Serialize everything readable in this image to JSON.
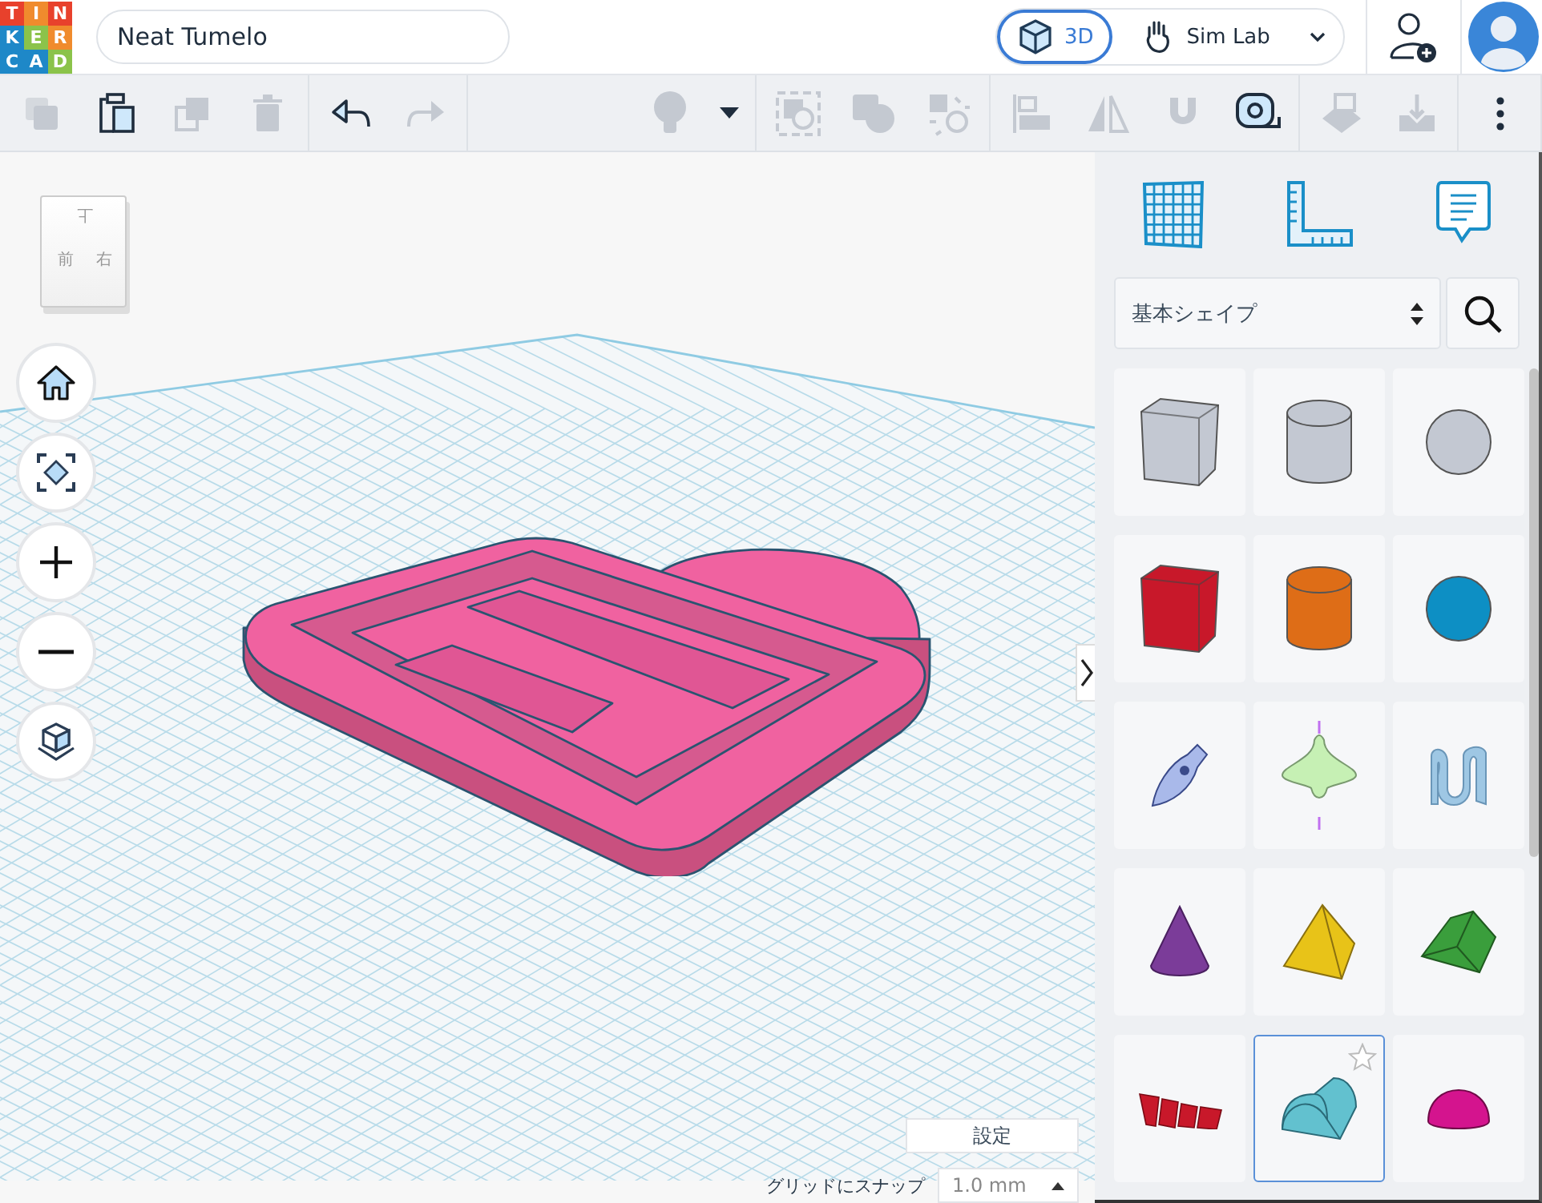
{
  "logo": {
    "letters": [
      {
        "char": "T",
        "color": "#e8412c"
      },
      {
        "char": "I",
        "color": "#f08b2d"
      },
      {
        "char": "N",
        "color": "#e8412c"
      },
      {
        "char": "K",
        "color": "#1e88c8"
      },
      {
        "char": "E",
        "color": "#8bc34a"
      },
      {
        "char": "R",
        "color": "#f08b2d"
      },
      {
        "char": "C",
        "color": "#1e88c8"
      },
      {
        "char": "A",
        "color": "#1e88c8"
      },
      {
        "char": "D",
        "color": "#8bc34a"
      }
    ]
  },
  "project_title": "Neat Tumelo",
  "mode_switch": [
    {
      "kind": "cube",
      "label": "3D",
      "selected": true
    },
    {
      "kind": "hand",
      "label": "Sim Lab",
      "selected": false
    }
  ],
  "toolbar": [
    [
      {
        "kind": "copy",
        "disabled": true
      },
      {
        "kind": "paste",
        "disabled": false
      },
      {
        "kind": "duplicate",
        "disabled": true
      },
      {
        "kind": "delete",
        "disabled": true
      }
    ],
    [
      {
        "kind": "undo",
        "disabled": false
      },
      {
        "kind": "redo",
        "disabled": true
      }
    ],
    [
      {
        "kind": "bulb",
        "disabled": true
      },
      {
        "kind": "caret",
        "disabled": false
      }
    ],
    [
      {
        "kind": "group",
        "disabled": true
      },
      {
        "kind": "combine",
        "disabled": true
      },
      {
        "kind": "scatter",
        "disabled": true
      }
    ],
    [
      {
        "kind": "align",
        "disabled": true
      },
      {
        "kind": "mirror",
        "disabled": true
      },
      {
        "kind": "magnet",
        "disabled": true
      },
      {
        "kind": "tape",
        "disabled": false
      }
    ],
    [
      {
        "kind": "export",
        "disabled": true
      },
      {
        "kind": "import",
        "disabled": true
      }
    ],
    [
      {
        "kind": "more",
        "disabled": false
      }
    ]
  ],
  "view_cube": {
    "top": "上",
    "front": "前",
    "right": "右"
  },
  "view_controls": [
    {
      "kind": "home"
    },
    {
      "kind": "fit"
    },
    {
      "kind": "zoom_in"
    },
    {
      "kind": "zoom_out"
    },
    {
      "kind": "ortho"
    }
  ],
  "panel_tabs": [
    {
      "kind": "grid"
    },
    {
      "kind": "ruler"
    },
    {
      "kind": "notes"
    }
  ],
  "shape_category": {
    "value": "基本シェイプ"
  },
  "shapes": [
    {
      "kind": "box_hole",
      "color": "#c3c8d2",
      "selected": false
    },
    {
      "kind": "cylinder_hole",
      "color": "#c3c8d2",
      "selected": false
    },
    {
      "kind": "sphere_hole",
      "color": "#c3c8d2",
      "selected": false
    },
    {
      "kind": "box",
      "color": "#c8182a",
      "selected": false
    },
    {
      "kind": "cylinder",
      "color": "#de6d17",
      "selected": false
    },
    {
      "kind": "sphere",
      "color": "#0d8fc4",
      "selected": false
    },
    {
      "kind": "scribble",
      "color": "#a9b9ea",
      "selected": false
    },
    {
      "kind": "spin",
      "color": "#c6f0b4",
      "selected": false
    },
    {
      "kind": "wave",
      "color": "#9ec7e4",
      "selected": false
    },
    {
      "kind": "cone",
      "color": "#7b3c99",
      "selected": false
    },
    {
      "kind": "pyramid",
      "color": "#e8c318",
      "selected": false
    },
    {
      "kind": "roof",
      "color": "#3a9e3c",
      "selected": false
    },
    {
      "kind": "text",
      "color": "#c8182a",
      "selected": false
    },
    {
      "kind": "half_cylinder",
      "color": "#62c1cf",
      "selected": true
    },
    {
      "kind": "half_sphere",
      "color": "#d4148e",
      "selected": false
    }
  ],
  "settings_button": "設定",
  "snap": {
    "label": "グリッドにスナップ",
    "value": "1.0 mm"
  }
}
